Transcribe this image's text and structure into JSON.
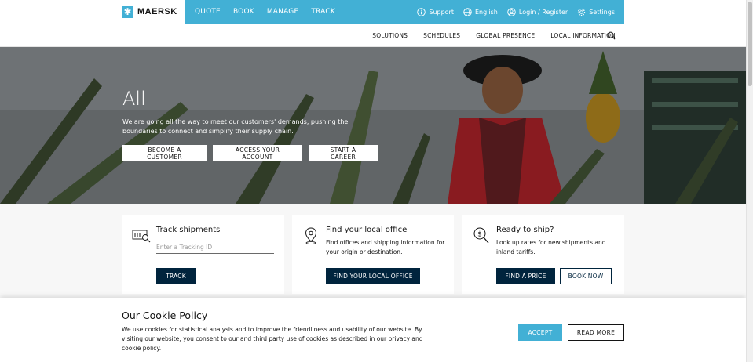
{
  "brand": {
    "name": "MAERSK",
    "icon": "star-logo-icon",
    "accent": "#42b0d5",
    "dark": "#00243d"
  },
  "main_nav": [
    "QUOTE",
    "BOOK",
    "MANAGE",
    "TRACK"
  ],
  "utility_nav": {
    "support": "Support",
    "language": "English",
    "login": "Login / Register",
    "settings": "Settings"
  },
  "sub_nav": [
    "SOLUTIONS",
    "SCHEDULES",
    "GLOBAL PRESENCE",
    "LOCAL INFORMATION"
  ],
  "hero": {
    "title": "All",
    "text": "We are going all the way to meet our customers' demands, pushing the boundaries to connect and simplify their supply chain.",
    "buttons": [
      "BECOME A CUSTOMER",
      "ACCESS YOUR ACCOUNT",
      "START A CAREER"
    ]
  },
  "cards": {
    "track": {
      "title": "Track shipments",
      "placeholder": "Enter a Tracking ID",
      "button": "TRACK"
    },
    "office": {
      "title": "Find your local office",
      "desc": "Find offices and shipping information for your origin or destination.",
      "button": "FIND YOUR LOCAL OFFICE"
    },
    "ship": {
      "title": "Ready to ship?",
      "desc": "Look up rates for new shipments and inland tariffs.",
      "button_primary": "FIND A PRICE",
      "button_secondary": "BOOK NOW"
    }
  },
  "cookie": {
    "title": "Our Cookie Policy",
    "text": "We use cookies for statistical analysis and to improve the friendliness and usability of our website. By visiting our website, you consent to our and third party use of cookies as described in our privacy and cookie policy.",
    "accept": "ACCEPT",
    "read_more": "READ MORE"
  }
}
